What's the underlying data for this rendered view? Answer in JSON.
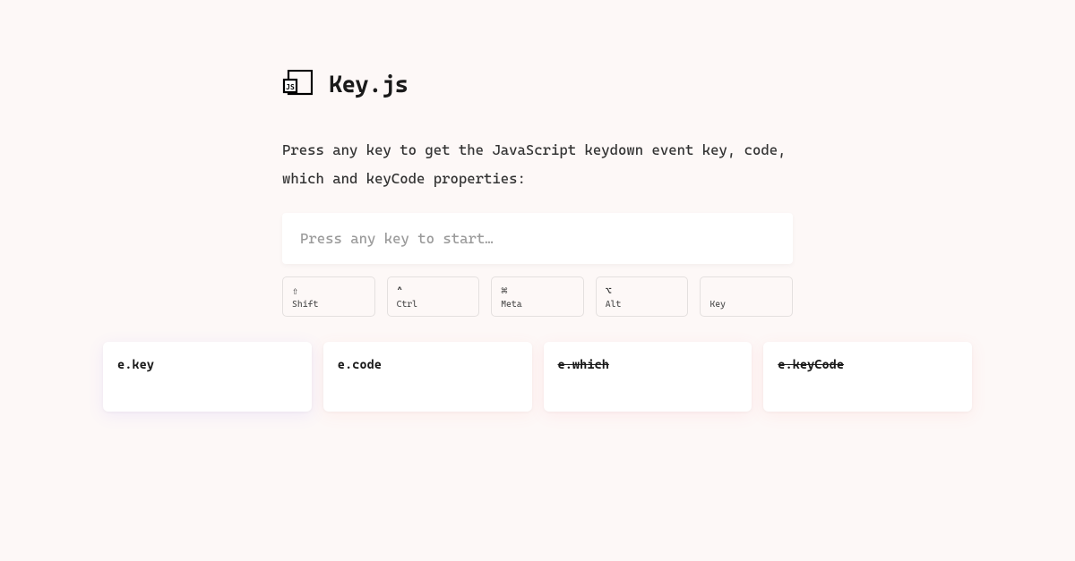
{
  "header": {
    "title": "Key.js"
  },
  "description": "Press any key to get the JavaScript keydown event key, code, which and keyCode properties:",
  "input": {
    "placeholder": "Press any key to start…"
  },
  "modifiers": [
    {
      "symbol": "⇧",
      "label": "Shift"
    },
    {
      "symbol": "^",
      "label": "Ctrl"
    },
    {
      "symbol": "⌘",
      "label": "Meta"
    },
    {
      "symbol": "⌥",
      "label": "Alt"
    },
    {
      "symbol": "",
      "label": "Key"
    }
  ],
  "results": [
    {
      "label": "e.key",
      "deprecated": false
    },
    {
      "label": "e.code",
      "deprecated": false
    },
    {
      "label": "e.which",
      "deprecated": true
    },
    {
      "label": "e.keyCode",
      "deprecated": true
    }
  ]
}
